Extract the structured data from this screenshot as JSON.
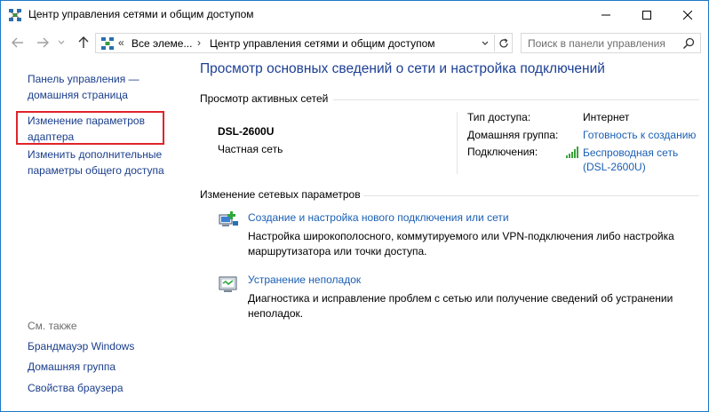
{
  "window": {
    "title": "Центр управления сетями и общим доступом"
  },
  "address_bar": {
    "prefix": "«",
    "crumb_1": "Все элеме...",
    "separator": "›",
    "crumb_2": "Центр управления сетями и общим доступом"
  },
  "search": {
    "placeholder": "Поиск в панели управления"
  },
  "sidebar": {
    "home_link": "Панель управления — домашняя страница",
    "adapter_link": "Изменение параметров адаптера",
    "sharing_link": "Изменить дополнительные параметры общего доступа",
    "see_also_heading": "См. также",
    "see_also": [
      "Брандмауэр Windows",
      "Домашняя группа",
      "Свойства браузера"
    ]
  },
  "main": {
    "title": "Просмотр основных сведений о сети и настройка подключений",
    "active_networks_heading": "Просмотр активных сетей",
    "network": {
      "name": "DSL-2600U",
      "type": "Частная сеть",
      "access_type_label": "Тип доступа:",
      "access_type_value": "Интернет",
      "homegroup_label": "Домашняя группа:",
      "homegroup_value": "Готовность к созданию",
      "connections_label": "Подключения:",
      "connection_line1": "Беспроводная сеть",
      "connection_line2": "(DSL-2600U)"
    },
    "change_settings_heading": "Изменение сетевых параметров",
    "tasks": [
      {
        "icon": "network-setup-icon",
        "link": "Создание и настройка нового подключения или сети",
        "description": "Настройка широкополосного, коммутируемого или VPN-подключения либо настройка маршрутизатора или точки доступа."
      },
      {
        "icon": "troubleshoot-icon",
        "link": "Устранение неполадок",
        "description": "Диагностика и исправление проблем с сетью или получение сведений об устранении неполадок."
      }
    ]
  },
  "colors": {
    "link": "#1a5fb4",
    "nav_link": "#1a3e8c",
    "title_blue": "#1c3f94",
    "highlight_border": "#e0242a",
    "window_border": "#1e78c8"
  }
}
